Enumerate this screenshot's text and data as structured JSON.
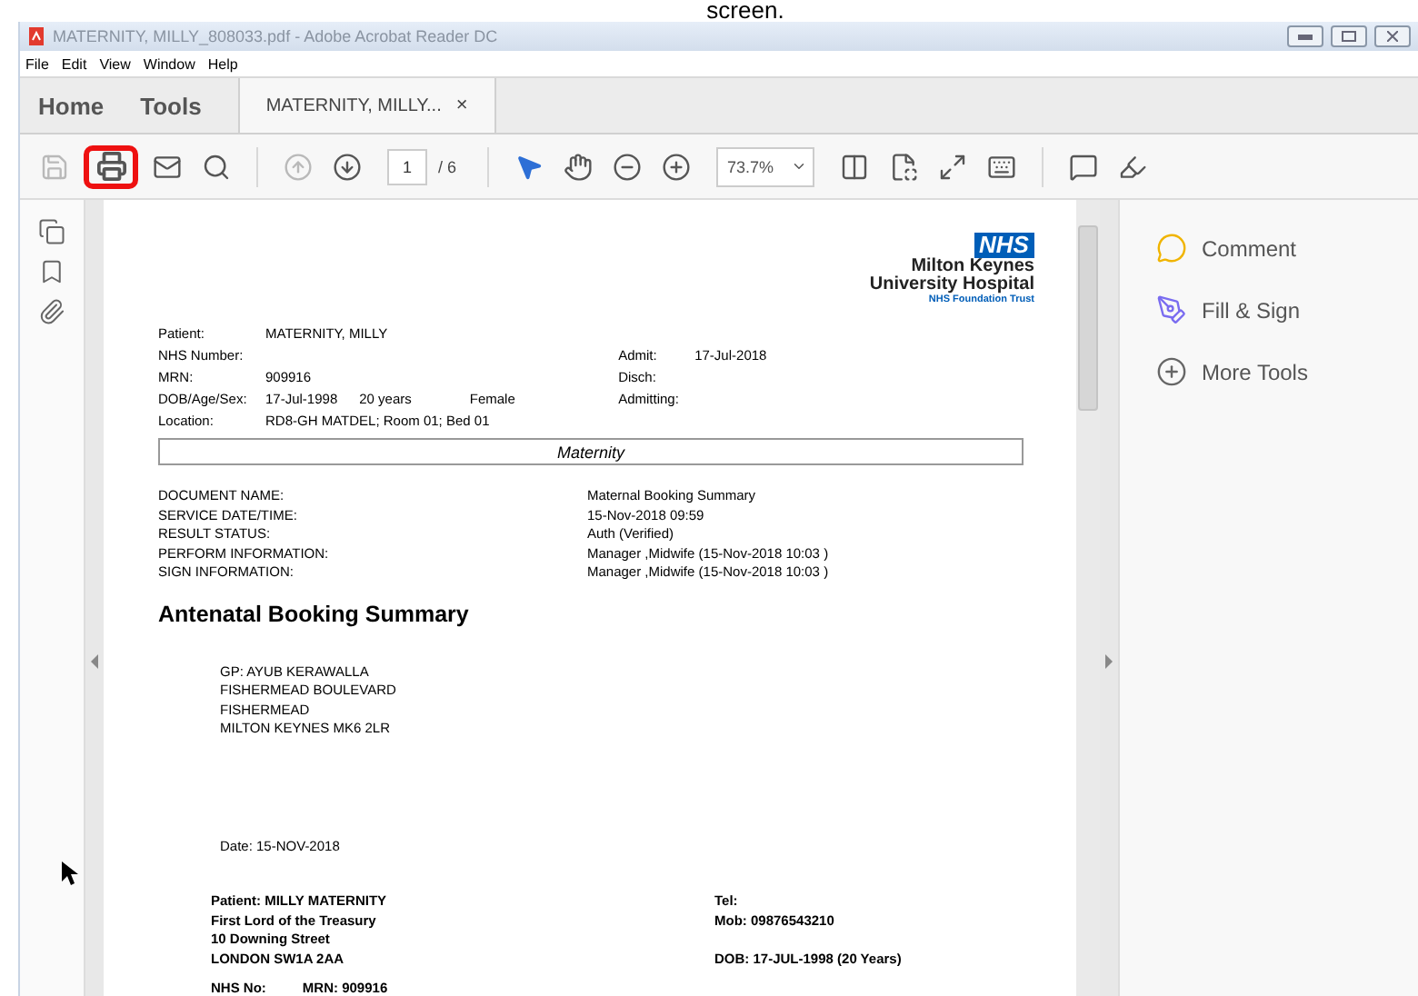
{
  "caption": "screen.",
  "window": {
    "title": "MATERNITY, MILLY_808033.pdf - Adobe Acrobat Reader DC"
  },
  "menu": [
    "File",
    "Edit",
    "View",
    "Window",
    "Help"
  ],
  "nav_tabs": [
    {
      "label": "Home",
      "selected": false
    },
    {
      "label": "Tools",
      "selected": false
    }
  ],
  "doc_tab": {
    "label": "MATERNITY, MILLY...",
    "close": "×",
    "selected": true
  },
  "toolbar": {
    "tools": [
      {
        "kind": "save",
        "disabled": true,
        "highlighted": false
      },
      {
        "kind": "print",
        "disabled": false,
        "highlighted": true
      },
      {
        "kind": "mail",
        "disabled": false,
        "highlighted": false
      },
      {
        "kind": "search",
        "disabled": false,
        "highlighted": false
      },
      {
        "kind": "sep"
      },
      {
        "kind": "prev",
        "disabled": true,
        "highlighted": false
      },
      {
        "kind": "next",
        "disabled": false,
        "highlighted": false
      },
      {
        "kind": "page"
      },
      {
        "kind": "sep"
      },
      {
        "kind": "select",
        "disabled": false,
        "highlighted": false,
        "selected": true
      },
      {
        "kind": "hand",
        "disabled": false,
        "highlighted": false,
        "selected": false
      },
      {
        "kind": "zoomout",
        "disabled": false,
        "highlighted": false
      },
      {
        "kind": "zoomin",
        "disabled": false,
        "highlighted": false
      },
      {
        "kind": "zoom"
      },
      {
        "kind": "fitwidth",
        "disabled": false,
        "highlighted": false
      },
      {
        "kind": "fitpage",
        "disabled": false,
        "highlighted": false
      },
      {
        "kind": "fullscreen",
        "disabled": false,
        "highlighted": false
      },
      {
        "kind": "keyboard",
        "disabled": false,
        "highlighted": false
      },
      {
        "kind": "sep"
      },
      {
        "kind": "comment",
        "disabled": false,
        "highlighted": false
      },
      {
        "kind": "highlight",
        "disabled": false,
        "highlighted": false
      }
    ],
    "page_value": "1",
    "page_total": "/ 6",
    "zoom_value": "73.7%"
  },
  "left_rail": [
    {
      "kind": "pages"
    },
    {
      "kind": "bookmark"
    },
    {
      "kind": "attachment"
    }
  ],
  "document": {
    "logo": {
      "badge": "NHS",
      "lines": [
        "Milton Keynes",
        "University Hospital"
      ],
      "trust": "NHS Foundation Trust"
    },
    "patient_info": [
      {
        "label": "Patient:",
        "values": [
          "MATERNITY, MILLY"
        ]
      },
      {
        "label": "NHS Number:"
      },
      {
        "label": "MRN:",
        "values": [
          "909916"
        ]
      },
      {
        "label": "DOB/Age/Sex:",
        "values": [
          "17-Jul-1998",
          "20 years",
          "Female"
        ]
      },
      {
        "label": "Location:",
        "values": [
          "RD8-GH MATDEL; Room 01; Bed 01"
        ]
      }
    ],
    "admission_info": [
      {
        "label": "Admit:",
        "value": "17-Jul-2018"
      },
      {
        "label": "Disch:"
      },
      {
        "label": "Admitting:"
      }
    ],
    "section": "Maternity",
    "doc_info": [
      {
        "label": "DOCUMENT NAME:",
        "value": "Maternal Booking Summary"
      },
      {
        "label": "SERVICE DATE/TIME:",
        "value": "15-Nov-2018 09:59"
      },
      {
        "label": "RESULT STATUS:",
        "value": "Auth (Verified)"
      },
      {
        "label": "PERFORM INFORMATION:",
        "value": "Manager ,Midwife (15-Nov-2018 10:03 )"
      },
      {
        "label": "SIGN INFORMATION:",
        "value": "Manager ,Midwife (15-Nov-2018 10:03 )"
      }
    ],
    "heading": "Antenatal Booking Summary",
    "gp_address": [
      "GP:  AYUB KERAWALLA",
      "FISHERMEAD BOULEVARD",
      "FISHERMEAD",
      "MILTON KEYNES MK6 2LR"
    ],
    "date": "Date: 15-NOV-2018",
    "patient_block": [
      {
        "left": "Patient: MILLY MATERNITY",
        "right": "Tel:"
      },
      {
        "left": "First Lord of the Treasury",
        "right": "Mob: 09876543210"
      },
      {
        "left": "10 Downing Street"
      },
      {
        "left": "LONDON SW1A 2AA",
        "right": "DOB: 17-JUL-1998 (20 Years)"
      }
    ],
    "footer_fields": [
      "NHS No:",
      "MRN: 909916"
    ]
  },
  "right_panel": [
    {
      "kind": "comment",
      "label": "Comment"
    },
    {
      "kind": "sign",
      "label": "Fill & Sign"
    },
    {
      "kind": "more",
      "label": "More Tools"
    }
  ]
}
